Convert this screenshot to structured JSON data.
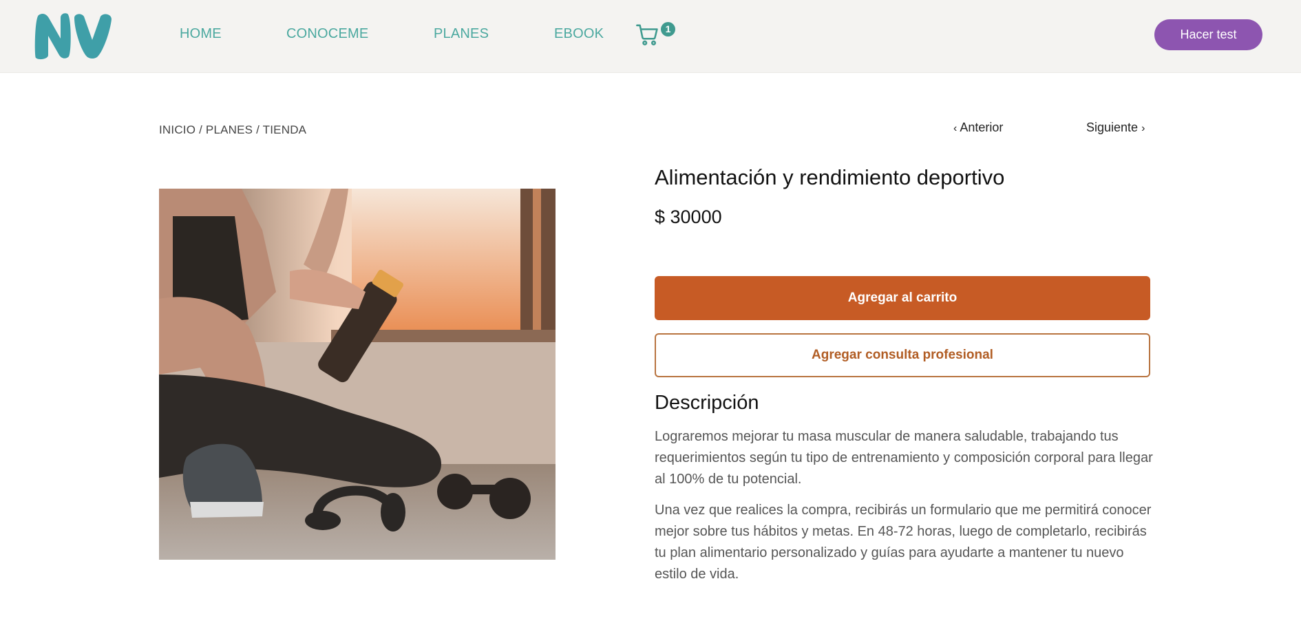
{
  "header": {
    "logo_text": "NV",
    "nav": [
      "HOME",
      "CONOCEME",
      "PLANES",
      "EBOOK"
    ],
    "cart_count": "1",
    "cta_label": "Hacer test"
  },
  "breadcrumb": "INICIO / PLANES / TIENDA",
  "pager": {
    "prev": "Anterior",
    "next": "Siguiente"
  },
  "product": {
    "title": "Alimentación y rendimiento deportivo",
    "price": "$ 30000",
    "add_to_cart": "Agregar al carrito",
    "add_consult": "Agregar consulta profesional",
    "description_title": "Descripción",
    "description": [
      "Lograremos mejorar tu masa muscular de manera saludable, trabajando tus requerimientos según tu tipo de entrenamiento y composición corporal para llegar al 100% de tu potencial.",
      "Una vez que realices la compra, recibirás un formulario que me permitirá conocer mejor sobre tus hábitos y metas. En 48-72 horas, luego de completarlo, recibirás tu plan alimentario personalizado y guías para ayudarte a mantener tu nuevo estilo de vida."
    ]
  },
  "colors": {
    "brand_teal": "#3f9fa8",
    "nav_teal": "#4aa89f",
    "cta_purple": "#8d55b0",
    "primary_orange": "#c75b25"
  },
  "icons": [
    "logo",
    "cart-icon",
    "chevron-left-icon",
    "chevron-right-icon"
  ]
}
